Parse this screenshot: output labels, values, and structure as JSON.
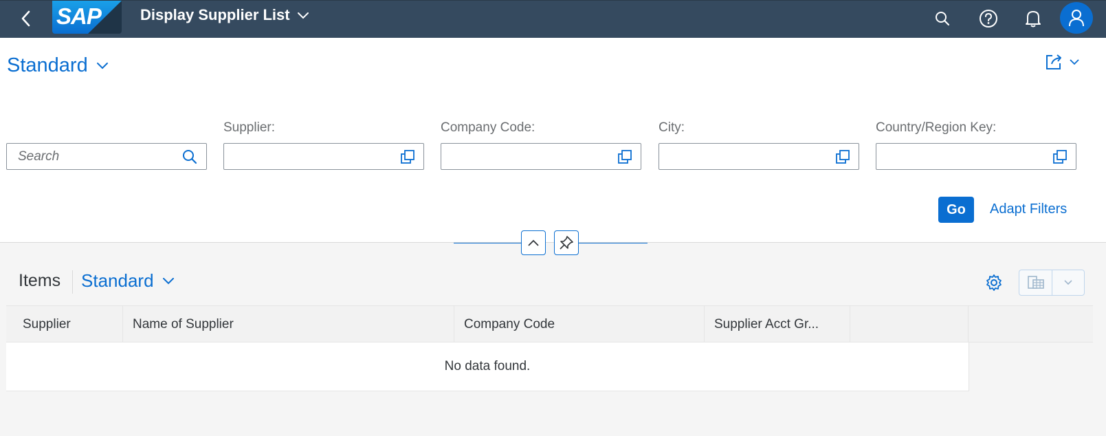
{
  "shell": {
    "logo_text": "SAP",
    "app_title": "Display Supplier List",
    "icons": [
      "chevron-left-icon",
      "search-icon",
      "help-icon",
      "bell-icon",
      "user-icon"
    ],
    "colors": {
      "shell_bg": "#354a5f",
      "accent": "#0a6ed1"
    }
  },
  "header": {
    "variant": "Standard",
    "search": {
      "placeholder": "Search",
      "value": ""
    },
    "filters": [
      {
        "label": "Supplier:",
        "value": ""
      },
      {
        "label": "Company Code:",
        "value": ""
      },
      {
        "label": "City:",
        "value": ""
      },
      {
        "label": "Country/Region Key:",
        "value": ""
      }
    ],
    "go_label": "Go",
    "adapt_label": "Adapt Filters"
  },
  "table": {
    "title": "Items",
    "variant": "Standard",
    "columns": [
      "Supplier",
      "Name of Supplier",
      "Company Code",
      "Supplier Acct Gr..."
    ],
    "empty_text": "No data found."
  }
}
